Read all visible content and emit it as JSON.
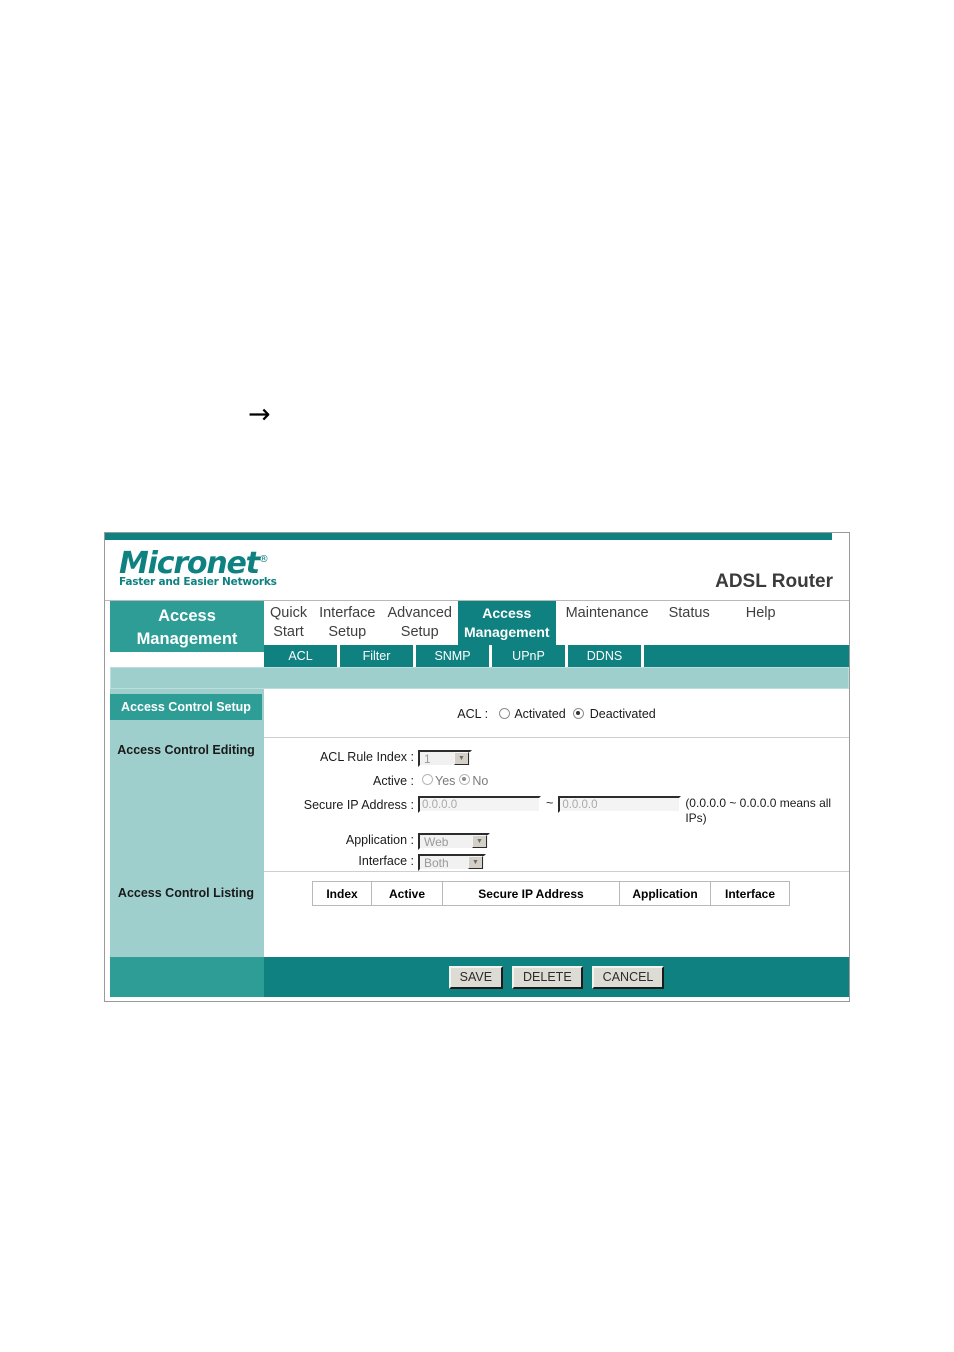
{
  "document": {
    "arrow_glyph": "→"
  },
  "window": {
    "brand": {
      "logo_text": "Micronet",
      "registered_mark": "®",
      "tagline": "Faster and Easier Networks",
      "logo_color": "#0e8180"
    },
    "device_title": "ADSL Router"
  },
  "sidebar": {
    "title": "Access Management",
    "items": [
      {
        "label": "Access Control Setup",
        "active": true
      },
      {
        "label": "Access Control Editing",
        "active": false
      },
      {
        "label": "Access Control Listing",
        "active": false
      }
    ]
  },
  "nav": {
    "items": [
      {
        "label": "Quick\nStart",
        "active": false
      },
      {
        "label": "Interface\nSetup",
        "active": false
      },
      {
        "label": "Advanced\nSetup",
        "active": false
      },
      {
        "label": "Access\nManagement",
        "active": true
      },
      {
        "label": "Maintenance",
        "active": false
      },
      {
        "label": "Status",
        "active": false
      },
      {
        "label": "Help",
        "active": false
      }
    ]
  },
  "subnav": {
    "items": [
      {
        "label": "ACL",
        "active": true
      },
      {
        "label": "Filter",
        "active": false
      },
      {
        "label": "SNMP",
        "active": false
      },
      {
        "label": "UPnP",
        "active": false
      },
      {
        "label": "DDNS",
        "active": false
      }
    ]
  },
  "acl_setup": {
    "label": "ACL :",
    "options": [
      {
        "label": "Activated",
        "selected": false
      },
      {
        "label": "Deactivated",
        "selected": true
      }
    ]
  },
  "acl_editing": {
    "rule_index": {
      "label": "ACL Rule Index :",
      "value": "1"
    },
    "active": {
      "label": "Active :",
      "options": [
        {
          "label": "Yes",
          "selected": false
        },
        {
          "label": "No",
          "selected": true
        }
      ]
    },
    "secure_ip": {
      "label": "Secure IP Address :",
      "start_value": "0.0.0.0",
      "end_value": "0.0.0.0",
      "separator": "~",
      "hint": "(0.0.0.0 ~ 0.0.0.0 means all IPs)"
    },
    "application": {
      "label": "Application :",
      "value": "Web"
    },
    "interface": {
      "label": "Interface :",
      "value": "Both"
    }
  },
  "acl_listing": {
    "columns": [
      "Index",
      "Active",
      "Secure IP Address",
      "Application",
      "Interface"
    ],
    "rows": []
  },
  "footer": {
    "buttons": [
      "SAVE",
      "DELETE",
      "CANCEL"
    ]
  },
  "colors": {
    "teal_dark": "#0e8180",
    "teal_mid": "#2d9d96",
    "teal_light": "#9fcfcd"
  }
}
